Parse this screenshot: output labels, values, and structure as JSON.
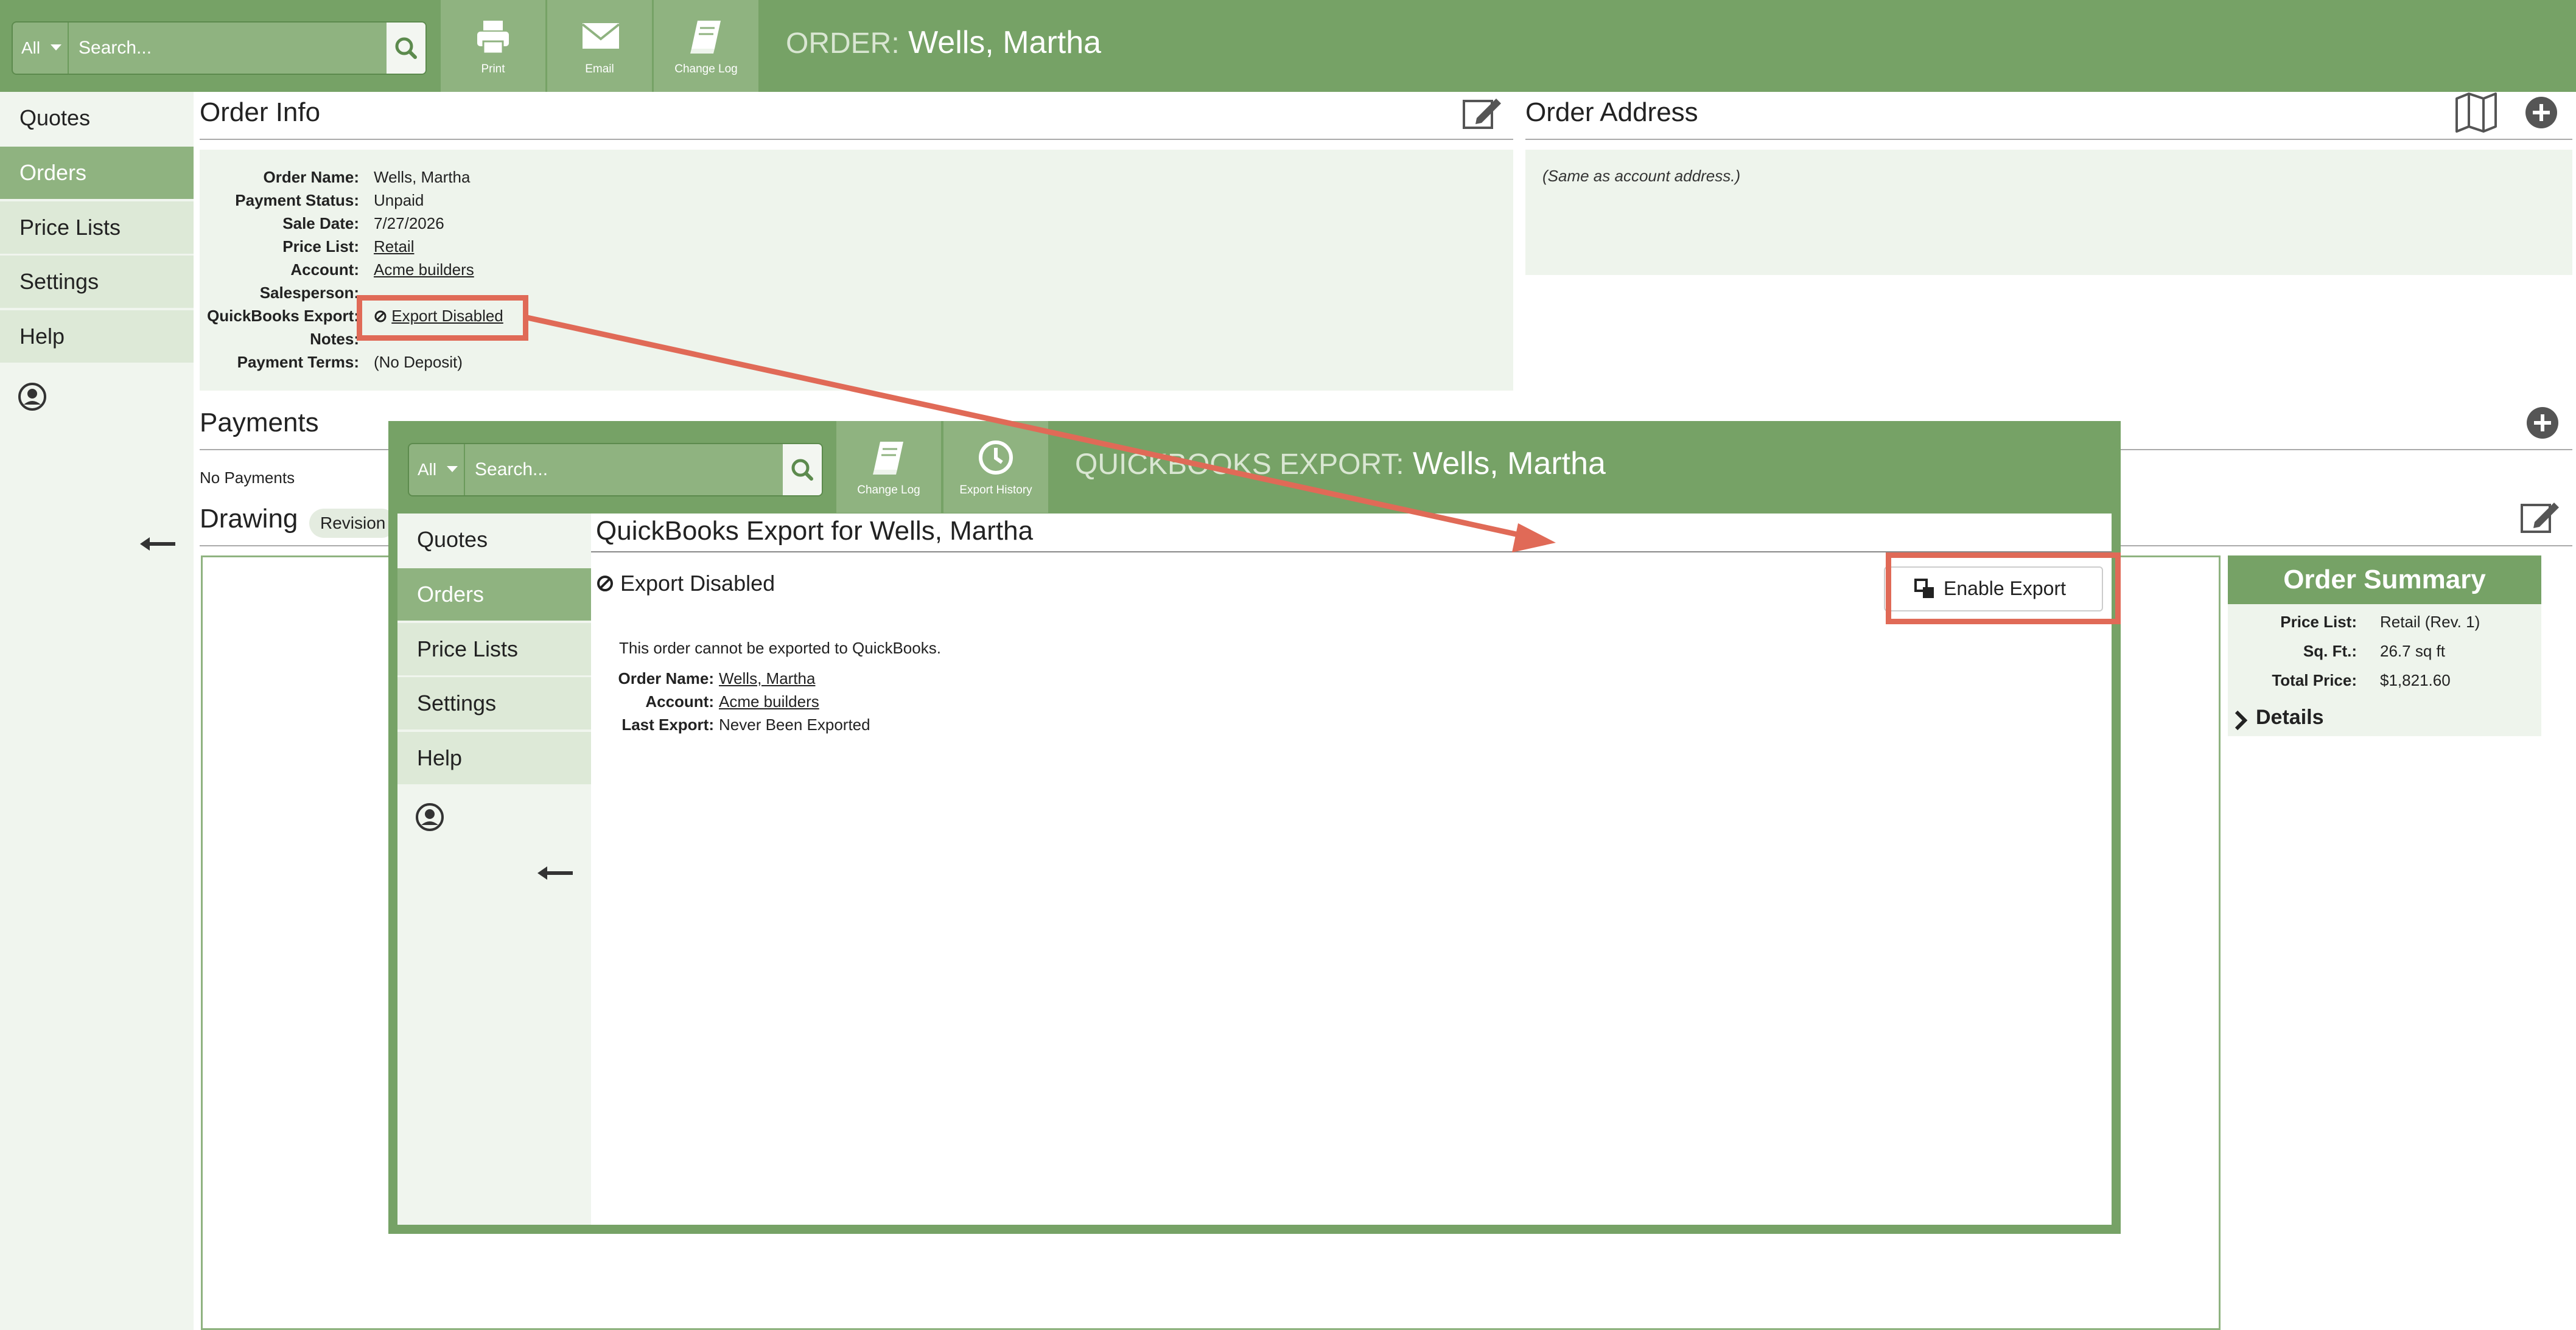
{
  "search": {
    "scope": "All",
    "placeholder": "Search..."
  },
  "toolbar": {
    "print": "Print",
    "email": "Email",
    "change_log": "Change Log"
  },
  "page_title": {
    "prefix": "ORDER:",
    "name": "Wells, Martha"
  },
  "nav": {
    "items": [
      "Quotes",
      "Orders",
      "Price Lists",
      "Settings",
      "Help"
    ],
    "active": "Orders"
  },
  "order_info": {
    "title": "Order Info",
    "fields": [
      {
        "label": "Order Name:",
        "value": "Wells, Martha"
      },
      {
        "label": "Payment Status:",
        "value": "Unpaid"
      },
      {
        "label": "Sale Date:",
        "value": "7/27/2026"
      },
      {
        "label": "Price List:",
        "value": "Retail"
      },
      {
        "label": "Account:",
        "value": "Acme builders"
      },
      {
        "label": "Salesperson:",
        "value": ""
      },
      {
        "label": "QuickBooks Export:",
        "value": "Export Disabled"
      },
      {
        "label": "Notes:",
        "value": ""
      },
      {
        "label": "Payment Terms:",
        "value": "(No Deposit)"
      }
    ]
  },
  "order_address": {
    "title": "Order Address",
    "note": "(Same as account address.)"
  },
  "payments": {
    "title": "Payments",
    "empty": "No Payments"
  },
  "drawing": {
    "title": "Drawing",
    "revision_label": "Revision"
  },
  "order_summary": {
    "title": "Order Summary",
    "rows": [
      {
        "label": "Price List:",
        "value": "Retail (Rev. 1)"
      },
      {
        "label": "Sq. Ft.:",
        "value": "26.7 sq ft"
      },
      {
        "label": "Total Price:",
        "value": "$1,821.60"
      }
    ],
    "details_label": "Details"
  },
  "overlay": {
    "search": {
      "scope": "All",
      "placeholder": "Search..."
    },
    "toolbar": {
      "change_log": "Change Log",
      "export_history": "Export History"
    },
    "title_prefix": "QUICKBOOKS EXPORT:",
    "title_name": "Wells, Martha",
    "nav_items": [
      "Quotes",
      "Orders",
      "Price Lists",
      "Settings",
      "Help"
    ],
    "heading": "QuickBooks Export for Wells, Martha",
    "status": "Export Disabled",
    "enable_button": "Enable Export",
    "message": "This order cannot be exported to QuickBooks.",
    "fields": [
      {
        "label": "Order Name:",
        "value": "Wells, Martha"
      },
      {
        "label": "Account:",
        "value": "Acme builders"
      },
      {
        "label": "Last Export:",
        "value": "Never Been Exported"
      }
    ]
  },
  "colors": {
    "brand_green": "#76a266",
    "light_green": "#8fb380",
    "panel_bg": "#eef4ec",
    "highlight": "#e06a57"
  }
}
